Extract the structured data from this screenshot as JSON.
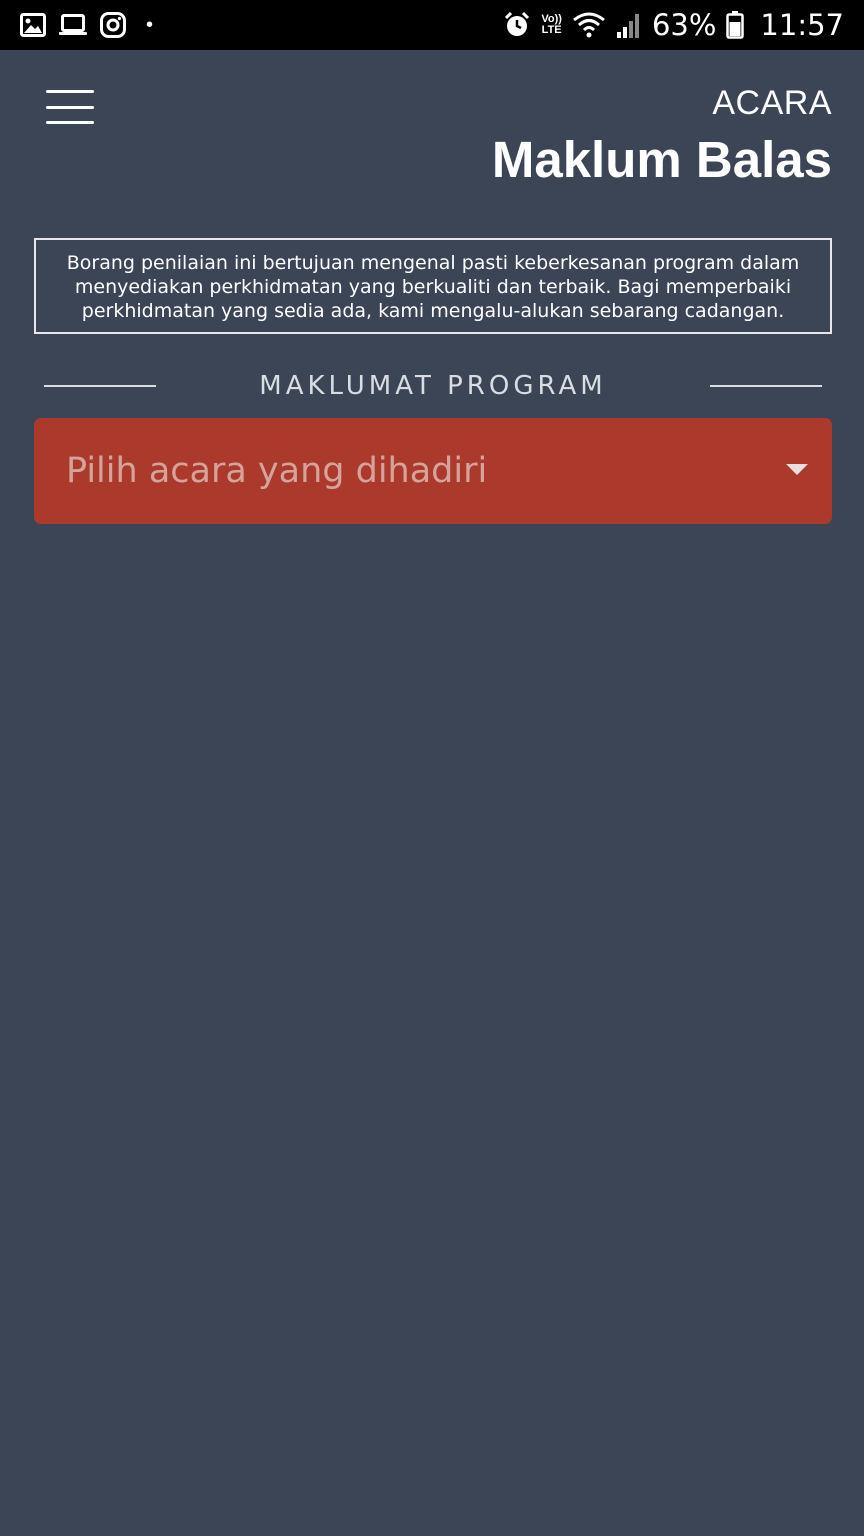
{
  "statusbar": {
    "left_icons": [
      "gallery-icon",
      "laptop-icon",
      "instagram-icon"
    ],
    "notification_dot": "•",
    "right_icons": [
      "alarm-icon",
      "volte-icon",
      "wifi-icon",
      "signal-icon",
      "battery-icon"
    ],
    "volte_top": "Vo))",
    "volte_bottom": "LTE",
    "battery_percent": "63%",
    "time": "11:57"
  },
  "header": {
    "menu_icon": "hamburger-menu-icon",
    "subtitle": "ACARA",
    "title": "Maklum Balas"
  },
  "info_box": {
    "text": "Borang penilaian ini bertujuan mengenal pasti keberkesanan program dalam menyediakan perkhidmatan yang berkualiti dan terbaik. Bagi memperbaiki perkhidmatan yang sedia ada, kami mengalu-alukan sebarang cadangan."
  },
  "section": {
    "label": "MAKLUMAT PROGRAM"
  },
  "event_select": {
    "placeholder": "Pilih acara yang dihadiri",
    "icon": "caret-down-icon"
  },
  "colors": {
    "background": "#3c4556",
    "select_background": "#ab3a2d",
    "statusbar": "#000000",
    "text": "#ffffff"
  }
}
